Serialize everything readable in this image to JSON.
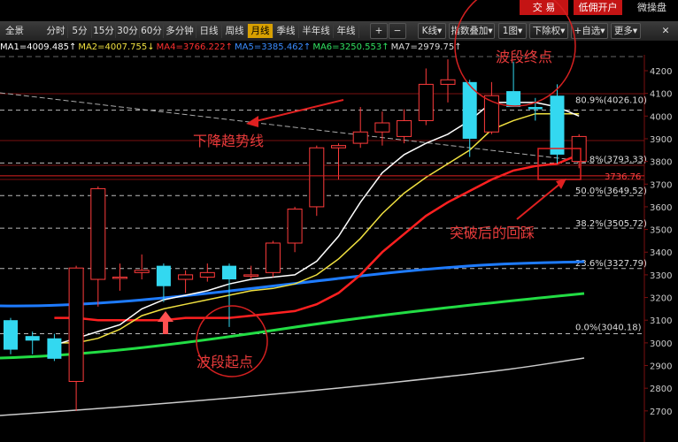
{
  "top_buttons": {
    "trade": "交 易",
    "low_commission": "低佣开户",
    "micro": "微操盘"
  },
  "toolbar": {
    "home": "全景",
    "periods": [
      "分时",
      "5分",
      "15分",
      "30分",
      "60分",
      "多分钟",
      "日线",
      "周线",
      "月线",
      "季线",
      "半年线",
      "年线"
    ],
    "active_period": "月线",
    "zoom_in": "+",
    "zoom_out": "−",
    "chart_type": "K线",
    "chart_type_arrow": "▾",
    "indicator_overlay": "指数叠加",
    "indicator_arrow": "▾",
    "layout": "1图",
    "layout_arrow": "▾",
    "adjust": "下除权",
    "adjust_arrow": "▾",
    "watchlist": "+自选",
    "watchlist_arrow": "▾",
    "more": "更多",
    "more_arrow": "▾",
    "close": "✕"
  },
  "ma_legend": [
    {
      "label": "MA1=4009.485",
      "arrow": "↑",
      "color": "#ffffff"
    },
    {
      "label": "MA2=4007.755",
      "arrow": "↓",
      "color": "#f0e040"
    },
    {
      "label": "MA4=3766.222",
      "arrow": "↑",
      "color": "#ff3030"
    },
    {
      "label": "MA5=3385.462",
      "arrow": "↑",
      "color": "#3a8cff"
    },
    {
      "label": "MA6=3250.553",
      "arrow": "↑",
      "color": "#30e060"
    },
    {
      "label": "MA7=2979.75",
      "arrow": "↑",
      "color": "#dddddd"
    }
  ],
  "annotations": {
    "wave_end": "波段终点",
    "downtrend": "下降趋势线",
    "pullback": "突破后的回踩",
    "wave_start": "波段起点"
  },
  "chart_data": {
    "type": "candlestick",
    "y_axis": {
      "min": 2700,
      "max": 4300,
      "ticks": [
        2700,
        2800,
        2900,
        3000,
        3100,
        3200,
        3300,
        3400,
        3500,
        3600,
        3700,
        3800,
        3900,
        4000,
        4100,
        4200
      ]
    },
    "candles": [
      {
        "o": 3100,
        "h": 3110,
        "l": 2950,
        "c": 2970
      },
      {
        "o": 3030,
        "h": 3050,
        "l": 2950,
        "c": 3010
      },
      {
        "o": 3020,
        "h": 3040,
        "l": 2920,
        "c": 2930
      },
      {
        "o": 2830,
        "h": 3340,
        "l": 2700,
        "c": 3330
      },
      {
        "o": 3280,
        "h": 3690,
        "l": 3160,
        "c": 3680
      },
      {
        "o": 3290,
        "h": 3350,
        "l": 3230,
        "c": 3290
      },
      {
        "o": 3310,
        "h": 3390,
        "l": 3280,
        "c": 3320
      },
      {
        "o": 3340,
        "h": 3350,
        "l": 3180,
        "c": 3250
      },
      {
        "o": 3280,
        "h": 3320,
        "l": 3220,
        "c": 3300
      },
      {
        "o": 3290,
        "h": 3350,
        "l": 3270,
        "c": 3310
      },
      {
        "o": 3340,
        "h": 3350,
        "l": 3070,
        "c": 3280
      },
      {
        "o": 3300,
        "h": 3340,
        "l": 3280,
        "c": 3300
      },
      {
        "o": 3310,
        "h": 3450,
        "l": 3290,
        "c": 3440
      },
      {
        "o": 3440,
        "h": 3600,
        "l": 3400,
        "c": 3590
      },
      {
        "o": 3600,
        "h": 3870,
        "l": 3560,
        "c": 3860
      },
      {
        "o": 3860,
        "h": 3880,
        "l": 3720,
        "c": 3870
      },
      {
        "o": 3880,
        "h": 4040,
        "l": 3860,
        "c": 3930
      },
      {
        "o": 3930,
        "h": 4020,
        "l": 3870,
        "c": 3970
      },
      {
        "o": 3910,
        "h": 4030,
        "l": 3880,
        "c": 3980
      },
      {
        "o": 3980,
        "h": 4210,
        "l": 3960,
        "c": 4140
      },
      {
        "o": 4140,
        "h": 4250,
        "l": 4060,
        "c": 4160
      },
      {
        "o": 4150,
        "h": 4160,
        "l": 3820,
        "c": 3900
      },
      {
        "o": 3930,
        "h": 4150,
        "l": 3920,
        "c": 4090
      },
      {
        "o": 4110,
        "h": 4240,
        "l": 4070,
        "c": 4040
      },
      {
        "o": 4040,
        "h": 4080,
        "l": 3980,
        "c": 4030
      },
      {
        "o": 4090,
        "h": 4140,
        "l": 3790,
        "c": 3830
      },
      {
        "o": 3800,
        "h": 3920,
        "l": 3770,
        "c": 3910
      }
    ],
    "ma_lines": {
      "MA_white": [
        2990,
        3020,
        3050,
        3080,
        3150,
        3190,
        3210,
        3230,
        3260,
        3280,
        3290,
        3300,
        3360,
        3470,
        3620,
        3750,
        3830,
        3880,
        3920,
        3980,
        4060,
        4060,
        4060,
        4040,
        4000
      ],
      "MA_yellow": [
        3000,
        3000,
        3020,
        3060,
        3120,
        3150,
        3170,
        3190,
        3210,
        3230,
        3240,
        3260,
        3300,
        3370,
        3460,
        3570,
        3660,
        3730,
        3790,
        3850,
        3940,
        3980,
        4010,
        4010,
        4010
      ],
      "MA_red": [
        3110,
        3110,
        3100,
        3100,
        3100,
        3100,
        3110,
        3110,
        3110,
        3120,
        3130,
        3140,
        3170,
        3220,
        3300,
        3400,
        3480,
        3560,
        3620,
        3670,
        3720,
        3760,
        3780,
        3790,
        3830
      ]
    },
    "fib_levels": [
      {
        "label": "80.9%(4026.10)",
        "value": 4026.1
      },
      {
        "label": "61.8%(3793.33)",
        "value": 3793.33
      },
      {
        "label": "50.0%(3649.52)",
        "value": 3649.52
      },
      {
        "label": "38.2%(3505.72)",
        "value": 3505.72
      },
      {
        "label": "23.6%(3327.79)",
        "value": 3327.79
      },
      {
        "label": "0.0%(3040.18)",
        "value": 3040.18
      }
    ],
    "price_tag": "3736.76"
  }
}
